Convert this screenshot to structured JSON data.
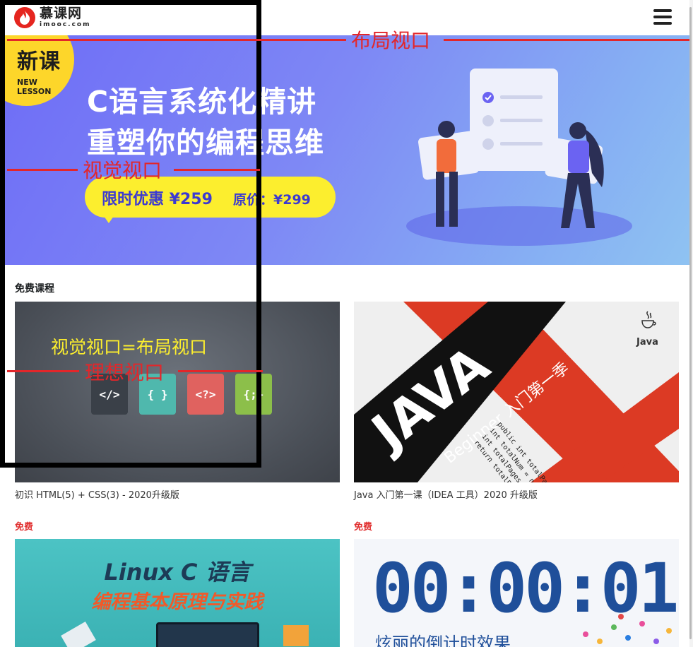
{
  "header": {
    "logo_cn": "慕课网",
    "logo_en": "imooc.com"
  },
  "banner": {
    "badge_big": "新课",
    "badge_small": "NEW LESSON",
    "title_line1": "C语言系统化精讲",
    "title_line2": "重塑你的编程思维",
    "price": "限时优惠 ¥259",
    "old_price": "原价：¥299"
  },
  "section": {
    "title": "免费课程"
  },
  "courses": [
    {
      "title": "初识 HTML(5) + CSS(3) - 2020升级版",
      "icons": [
        "</>",
        "{ }",
        "<?>",
        "{;}"
      ]
    },
    {
      "title": "Java 入门第一课（IDEA 工具）2020 升级版",
      "big": "JAVA",
      "sub": "Beginner 入门第一季",
      "code": [
        "public int totalPages(int pageN",
        "int totalNum = new UserDao(",
        "int totalPages = totalNu",
        "return totalPages"
      ],
      "logo": "Java"
    },
    {
      "tag": "免费",
      "line1": "Linux C 语言",
      "line2": "编程基本原理与实践"
    },
    {
      "tag": "免费",
      "clock": "00:00:01",
      "caption": "炫丽的倒计时效果"
    }
  ],
  "annotations": {
    "layout_viewport": "布局视口",
    "visual_viewport": "视觉视口",
    "equal": "视觉视口=布局视口",
    "ideal_viewport": "理想视口"
  },
  "colors": {
    "accent_red": "#e3262a",
    "price_yellow": "#fcee2e",
    "banner_purple": "#6e6cf6"
  }
}
